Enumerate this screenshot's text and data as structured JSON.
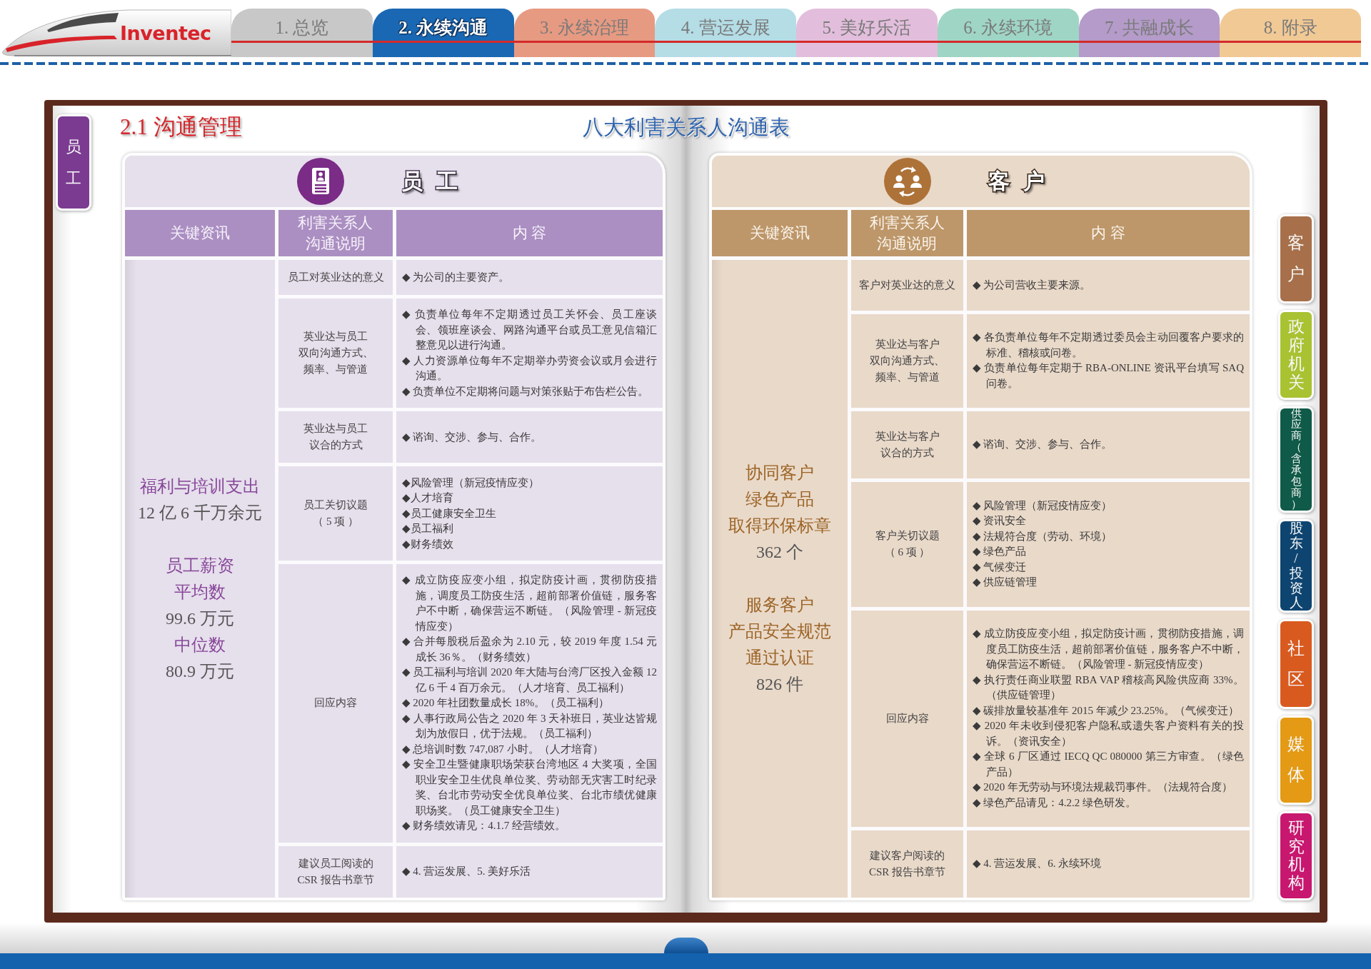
{
  "header": {
    "logo": "Inventec",
    "tabs": [
      {
        "label": "1. 总览",
        "selected": false,
        "color": "#c8c8c8"
      },
      {
        "label": "2. 永续沟通",
        "selected": true,
        "color": "#1a68b3"
      },
      {
        "label": "3. 永续治理",
        "selected": false,
        "color": "#e79a82"
      },
      {
        "label": "4. 营运发展",
        "selected": false,
        "color": "#b4dde6"
      },
      {
        "label": "5. 美好乐活",
        "selected": false,
        "color": "#e2bedc"
      },
      {
        "label": "6. 永续环境",
        "selected": false,
        "color": "#9fd5c5"
      },
      {
        "label": "7. 共融成长",
        "selected": false,
        "color": "#b49bc9"
      },
      {
        "label": "8. 附录",
        "selected": false,
        "color": "#f1c995"
      }
    ]
  },
  "section_title": "2.1 沟通管理",
  "table_title": "八大利害关系人沟通表",
  "left_tabs": [
    {
      "label": "员工",
      "color": "#7b3b91"
    }
  ],
  "panels": [
    {
      "kind": "employee",
      "title": "员 工",
      "columns": [
        "关键资讯",
        "利害关系人沟通说明",
        "内 容"
      ],
      "key_info": [
        [
          {
            "kind": "label",
            "text": "福利与培训支出"
          },
          {
            "kind": "value",
            "text": "12 亿 6 千万余元"
          }
        ],
        [
          {
            "kind": "label",
            "text": "员工薪资"
          },
          {
            "kind": "label",
            "text": "平均数"
          },
          {
            "kind": "value",
            "text": "99.6 万元"
          },
          {
            "kind": "label",
            "text": "中位数"
          },
          {
            "kind": "value",
            "text": "80.9 万元"
          }
        ]
      ],
      "rows": [
        {
          "topic": [
            "员工对英业达的意义"
          ],
          "items": [
            "◆ 为公司的主要资产。"
          ]
        },
        {
          "topic": [
            "英业达与员工",
            "双向沟通方式、",
            "频率、与管道"
          ],
          "items": [
            "◆ 负责单位每年不定期透过员工关怀会、员工座谈会、领班座谈会、网路沟通平台或员工意见信箱汇整意见以进行沟通。",
            "◆ 人力资源单位每年不定期举办劳资会议或月会进行沟通。",
            "◆ 负责单位不定期将问题与对策张贴于布告栏公告。"
          ]
        },
        {
          "topic": [
            "英业达与员工",
            "议合的方式"
          ],
          "items": [
            "◆ 谘询、交涉、参与、合作。"
          ]
        },
        {
          "topic": [
            "员工关切议题",
            "（ 5 项 ）"
          ],
          "items": [
            "◆风险管理（新冠疫情应变）",
            "◆人才培育",
            "◆员工健康安全卫生",
            "◆员工福利",
            "◆财务绩效"
          ]
        },
        {
          "topic": [
            "回应内容"
          ],
          "items": [
            "◆ 成立防疫应变小组，拟定防疫计画，贯彻防疫措施，调度员工防疫生活，超前部署价值链，服务客户不中断，确保营运不断链。（风险管理 - 新冠疫情应变）",
            "◆ 合并每股税后盈余为 2.10 元，较 2019 年度 1.54 元成长 36％。（财务绩效）",
            "◆ 员工福利与培训 2020 年大陆与台湾厂区投入金额 12 亿 6 千 4 百万余元。（人才培育、员工福利）",
            "◆ 2020 年社团数量成长 18%。（员工福利）",
            "◆ 人事行政局公告之 2020 年 3 天补班日，英业达皆规划为放假日，优于法规。（员工福利）",
            "◆ 总培训时数 747,087 小时。（人才培育）",
            "◆ 安全卫生暨健康职场荣获台湾地区 4 大奖项，全国职业安全卫生优良单位奖、劳动部无灾害工时纪录奖、台北市劳动安全优良单位奖、台北市绩优健康职场奖。（员工健康安全卫生）",
            "◆ 财务绩效请见：4.1.7 经营绩效。"
          ]
        },
        {
          "topic": [
            "建议员工阅读的",
            "CSR 报告书章节"
          ],
          "items": [
            "◆ 4. 营运发展、5. 美好乐活"
          ]
        }
      ]
    },
    {
      "kind": "customer",
      "title": "客 户",
      "columns": [
        "关键资讯",
        "利害关系人沟通说明",
        "内 容"
      ],
      "key_info": [
        [
          {
            "kind": "label",
            "text": "协同客户"
          },
          {
            "kind": "label",
            "text": "绿色产品"
          },
          {
            "kind": "label",
            "text": "取得环保标章"
          },
          {
            "kind": "value",
            "text": "362 个"
          }
        ],
        [
          {
            "kind": "label",
            "text": "服务客户"
          },
          {
            "kind": "label",
            "text": "产品安全规范"
          },
          {
            "kind": "label",
            "text": "通过认证"
          },
          {
            "kind": "value",
            "text": "826 件"
          }
        ]
      ],
      "rows": [
        {
          "topic": [
            "客户对英业达的意义"
          ],
          "items": [
            "◆ 为公司营收主要来源。"
          ]
        },
        {
          "topic": [
            "英业达与客户",
            "双向沟通方式、",
            "频率、与管道"
          ],
          "items": [
            "◆ 各负责单位每年不定期透过委员会主动回覆客户要求的标准、稽核或问卷。",
            "◆ 负责单位每年定期于 RBA-ONLINE 资讯平台填写 SAQ 问卷。"
          ]
        },
        {
          "topic": [
            "英业达与客户",
            "议合的方式"
          ],
          "items": [
            "◆ 谘询、交涉、参与、合作。"
          ]
        },
        {
          "topic": [
            "客户关切议题",
            "（ 6 项 ）"
          ],
          "items": [
            "◆ 风险管理（新冠疫情应变）",
            "◆ 资讯安全",
            "◆ 法规符合度（劳动、环境）",
            "◆ 绿色产品",
            "◆ 气候变迁",
            "◆ 供应链管理"
          ]
        },
        {
          "topic": [
            "回应内容"
          ],
          "items": [
            "◆ 成立防疫应变小组，拟定防疫计画，贯彻防疫措施，调度员工防疫生活，超前部署价值链，服务客户不中断，确保营运不断链。（风险管理 - 新冠疫情应变）",
            "◆ 执行责任商业联盟 RBA VAP 稽核高风险供应商 33%。（供应链管理）",
            "◆ 碳排放量较基准年 2015 年减少 23.25%。（气候变迁）",
            "◆ 2020 年未收到侵犯客户隐私或遗失客户资料有关的投诉。（资讯安全）",
            "◆ 全球 6 厂区通过 IECQ QC 080000 第三方审查。（绿色产品）",
            "◆ 2020 年无劳动与环境法规裁罚事件。（法规符合度）",
            "◆ 绿色产品请见：4.2.2 绿色研发。"
          ]
        },
        {
          "topic": [
            "建议客户阅读的",
            "CSR 报告书章节"
          ],
          "items": [
            "◆ 4. 营运发展、6. 永续环境"
          ]
        }
      ]
    }
  ],
  "right_tabs": [
    {
      "label": "客户",
      "color": "#a7704a"
    },
    {
      "label": "政府机关",
      "color": "#a8c232"
    },
    {
      "label": "供应商（含承包商）",
      "color": "#0f5a48"
    },
    {
      "label": "股东/投资人",
      "color": "#0e4470"
    },
    {
      "label": "社区",
      "color": "#d95a1f"
    },
    {
      "label": "媒体",
      "color": "#e49a14"
    },
    {
      "label": "研究机构",
      "color": "#c8176f"
    }
  ]
}
